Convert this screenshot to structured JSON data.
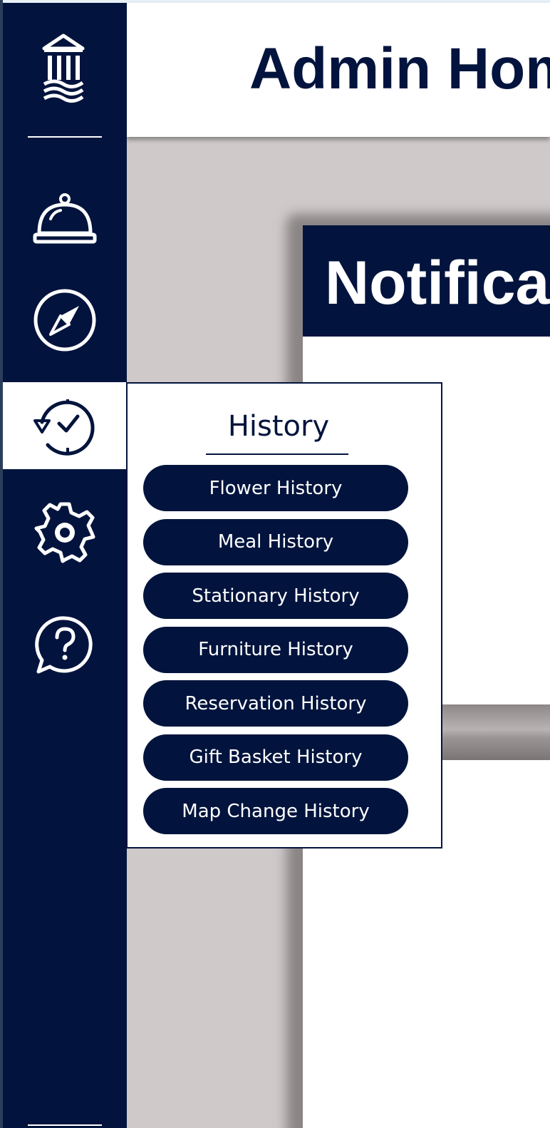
{
  "header": {
    "title": "Admin Home"
  },
  "sidebar": {
    "items": [
      {
        "icon": "service-bell-icon",
        "label": "Service Requests"
      },
      {
        "icon": "compass-icon",
        "label": "Map"
      },
      {
        "icon": "history-icon",
        "label": "History",
        "active": true
      },
      {
        "icon": "gear-icon",
        "label": "Settings"
      },
      {
        "icon": "help-icon",
        "label": "Help"
      }
    ]
  },
  "notifications": {
    "title": "Notifications"
  },
  "history_menu": {
    "title": "History",
    "items": [
      "Flower History",
      "Meal History",
      "Stationary History",
      "Furniture History",
      "Reservation History",
      "Gift Basket History",
      "Map Change History"
    ]
  },
  "colors": {
    "navy": "#02143d",
    "background": "#cfc9c9",
    "white": "#ffffff"
  }
}
